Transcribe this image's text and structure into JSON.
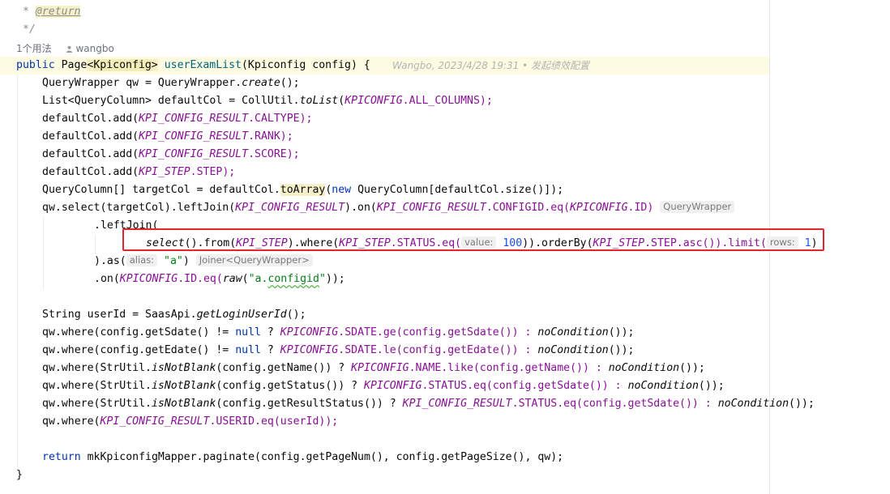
{
  "usage": {
    "count_label": "1个用法",
    "author": "wangbo"
  },
  "blame": {
    "text": "Wangbo, 2023/4/28 19:31 • 发起绩效配置"
  },
  "comment": {
    "line1_star": "*",
    "return_tag": "@return",
    "line2": "*/"
  },
  "signature": {
    "kw_public": "public",
    "type_page": "Page",
    "lt": "<",
    "generic": "Kpiconfig",
    "gt": ">",
    "method": "userExamList",
    "params": "(Kpiconfig config) {"
  },
  "lines": {
    "l1_a": "QueryWrapper qw = QueryWrapper.",
    "l1_b": "create",
    "l1_c": "();",
    "l2_a": "List<QueryColumn> defaultCol = CollUtil.",
    "l2_b": "toList",
    "l2_c": "(",
    "l2_d": "KPICONFIG",
    "l2_e": ".ALL_COLUMNS);",
    "l3_a": "defaultCol.add(",
    "l3_b": "KPI_CONFIG_RESULT",
    "l3_c": ".CALTYPE);",
    "l4_a": "defaultCol.add(",
    "l4_b": "KPI_CONFIG_RESULT",
    "l4_c": ".RANK);",
    "l5_a": "defaultCol.add(",
    "l5_b": "KPI_CONFIG_RESULT",
    "l5_c": ".SCORE);",
    "l6_a": "defaultCol.add(",
    "l6_b": "KPI_STEP",
    "l6_c": ".STEP);",
    "l7_a": "QueryColumn[] targetCol = defaultCol.",
    "l7_b": "toArray",
    "l7_c": "(",
    "l7_d": "new",
    "l7_e": " QueryColumn[defaultCol.size()]);",
    "l8_a": "qw.select(targetCol).leftJoin(",
    "l8_b": "KPI_CONFIG_RESULT",
    "l8_c": ").on(",
    "l8_d": "KPI_CONFIG_RESULT",
    "l8_e": ".CONFIGID.eq(",
    "l8_f": "KPICONFIG",
    "l8_g": ".ID)",
    "l8_hint": "QueryWrapper",
    "l9": ".leftJoin(",
    "l10_a": "select",
    "l10_b": "().from(",
    "l10_c": "KPI_STEP",
    "l10_d": ").where(",
    "l10_e": "KPI_STEP",
    "l10_f": ".STATUS.eq(",
    "l10_hint_value": "value:",
    "l10_num": "100",
    "l10_g": ")).orderBy(",
    "l10_h": "KPI_STEP",
    "l10_i": ".STEP.asc()).limit(",
    "l10_hint_rows": "rows:",
    "l10_num2": "1",
    "l10_j": ")",
    "l11_a": ").as(",
    "l11_hint_alias": "alias:",
    "l11_str": "\"a\"",
    "l11_b": ")",
    "l11_hint": "Joiner<QueryWrapper>",
    "l12_a": ".on(",
    "l12_b": "KPICONFIG",
    "l12_c": ".ID.eq(",
    "l12_d": "raw",
    "l12_e": "(",
    "l12_str1": "\"a.",
    "l12_str2": "configid",
    "l12_str3": "\"",
    "l12_f": "));",
    "l13_a": "String userId = SaasApi.",
    "l13_b": "getLoginUserId",
    "l13_c": "();",
    "w1": [
      "qw.where(config.getSdate() != ",
      "null",
      " ? ",
      "KPICONFIG",
      ".SDATE.ge(config.getSdate()) : ",
      "noCondition",
      "());"
    ],
    "w2": [
      "qw.where(config.getEdate() != ",
      "null",
      " ? ",
      "KPICONFIG",
      ".SDATE.le(config.getEdate()) : ",
      "noCondition",
      "());"
    ],
    "w3": [
      "qw.where(StrUtil.",
      "isNotBlank",
      "(config.getName()) ? ",
      "KPICONFIG",
      ".NAME.like(config.getName()) : ",
      "noCondition",
      "());"
    ],
    "w4": [
      "qw.where(StrUtil.",
      "isNotBlank",
      "(config.getStatus()) ? ",
      "KPICONFIG",
      ".STATUS.eq(config.getSdate()) : ",
      "noCondition",
      "());"
    ],
    "w5": [
      "qw.where(StrUtil.",
      "isNotBlank",
      "(config.getResultStatus()) ? ",
      "KPI_CONFIG_RESULT",
      ".STATUS.eq(config.getSdate()) : ",
      "noCondition",
      "());"
    ],
    "w6_a": "qw.where(",
    "w6_b": "KPI_CONFIG_RESULT",
    "w6_c": ".USERID.eq(userId));",
    "ret_kw": "return",
    "ret_rest": " mkKpiconfigMapper.paginate(config.getPageNum(), config.getPageSize(), qw);",
    "close": "}"
  },
  "colors": {
    "keyword": "#0033b3",
    "method": "#00627a",
    "static_field": "#871094",
    "number": "#1750eb",
    "string": "#067d17",
    "highlight_box": "#e8232b"
  }
}
